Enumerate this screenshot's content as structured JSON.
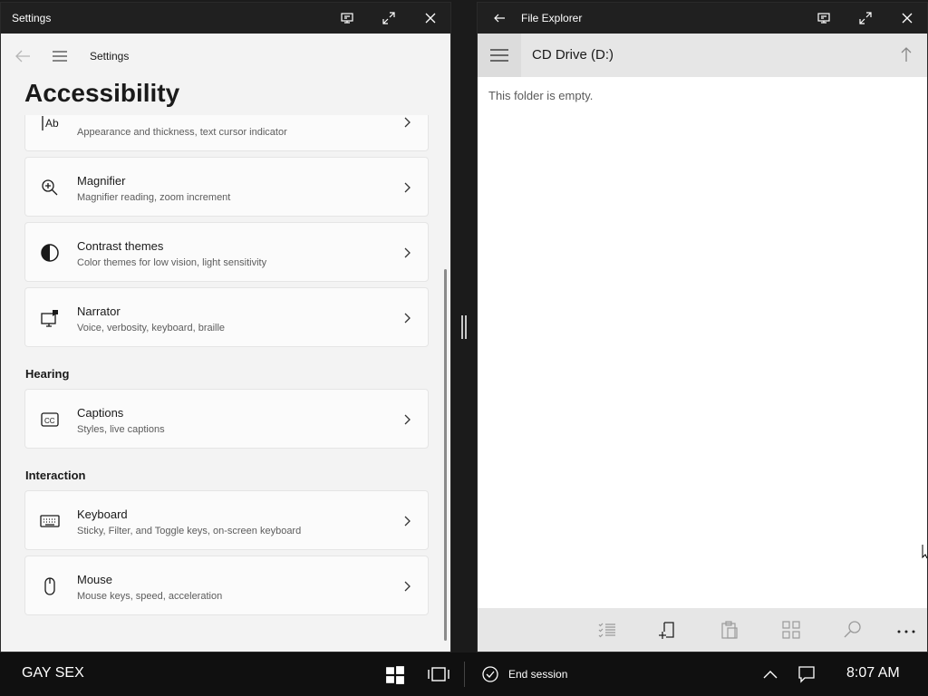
{
  "settings_window": {
    "title": "Settings",
    "nav_label": "Settings",
    "page_title": "Accessibility",
    "items": [
      {
        "label": "",
        "description": "Appearance and thickness, text cursor indicator",
        "icon": "text-cursor-icon"
      },
      {
        "label": "Magnifier",
        "description": "Magnifier reading, zoom increment",
        "icon": "magnifier-icon"
      },
      {
        "label": "Contrast themes",
        "description": "Color themes for low vision, light sensitivity",
        "icon": "contrast-icon"
      },
      {
        "label": "Narrator",
        "description": "Voice, verbosity, keyboard, braille",
        "icon": "narrator-icon"
      }
    ],
    "sections": [
      {
        "heading": "Hearing",
        "items": [
          {
            "label": "Captions",
            "description": "Styles, live captions",
            "icon": "captions-icon"
          }
        ]
      },
      {
        "heading": "Interaction",
        "items": [
          {
            "label": "Keyboard",
            "description": "Sticky, Filter, and Toggle keys, on-screen keyboard",
            "icon": "keyboard-icon"
          },
          {
            "label": "Mouse",
            "description": "Mouse keys, speed, acceleration",
            "icon": "mouse-icon"
          }
        ]
      }
    ]
  },
  "explorer_window": {
    "title": "File Explorer",
    "location": "CD Drive (D:)",
    "empty_message": "This folder is empty."
  },
  "taskbar": {
    "left_text": "GAY SEX",
    "end_session_label": "End session",
    "clock": "8:07 AM"
  }
}
